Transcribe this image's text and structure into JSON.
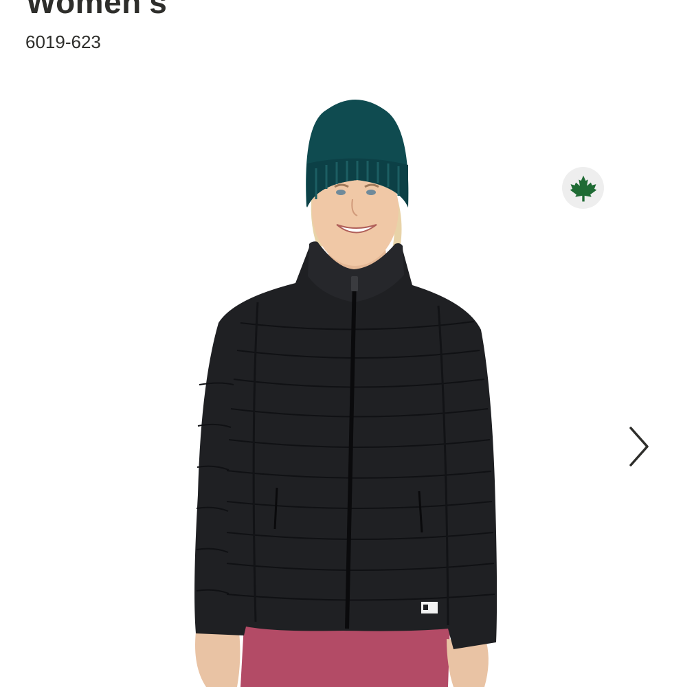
{
  "product": {
    "title": "Women's",
    "sku": "6019-623"
  },
  "gallery": {
    "image_alt": "Model wearing black down jacket, teal beanie and pink pants",
    "badge_icon": "maple-leaf-icon",
    "next_icon": "chevron-right-icon"
  },
  "colors": {
    "text": "#2e2e2b",
    "maple_leaf": "#1f6b34",
    "badge_bg": "#eeeeee",
    "jacket": "#1f2023",
    "beanie": "#0f4b50",
    "pants": "#b34b66"
  }
}
